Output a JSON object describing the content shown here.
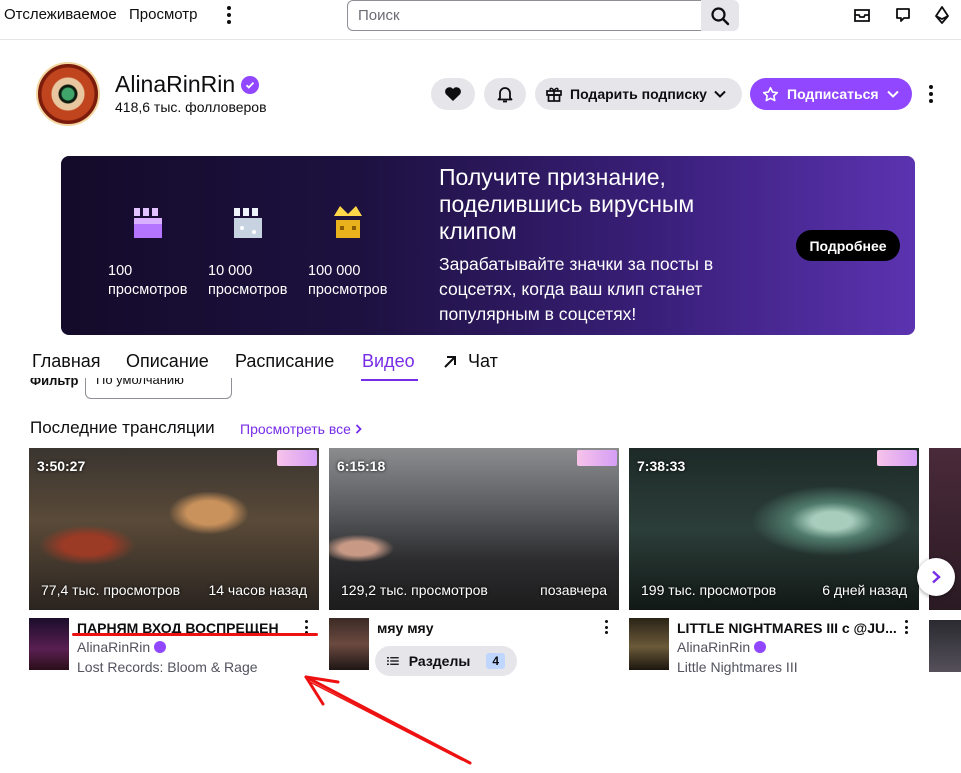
{
  "topnav": {
    "following": "Отслеживаемое",
    "browse": "Просмотр",
    "search_placeholder": "Поиск"
  },
  "channel": {
    "name": "AlinaRinRin",
    "followers": "418,6 тыс. фолловеров",
    "gift_label": "Подарить подписку",
    "subscribe_label": "Подписаться"
  },
  "banner": {
    "tiers": [
      {
        "count": "100",
        "label": "просмотров"
      },
      {
        "count": "10 000",
        "label": "просмотров"
      },
      {
        "count": "100 000",
        "label": "просмотров"
      }
    ],
    "title": "Получите признание, поделившись вирусным клипом",
    "text": "Зарабатывайте значки за посты в соцсетях, когда ваш клип станет популярным в соцсетях!",
    "button": "Подробнее"
  },
  "tabs": [
    "Главная",
    "Описание",
    "Расписание",
    "Видео",
    "Чат"
  ],
  "filter": {
    "label": "Фильтр",
    "value": "По умолчанию"
  },
  "section": {
    "title": "Последние трансляции",
    "view_all": "Просмотреть все"
  },
  "videos": [
    {
      "duration": "3:50:27",
      "views": "77,4 тыс. просмотров",
      "ago": "14 часов назад",
      "title": "ПАРНЯМ ВХОД ВОСПРЕЩЕН",
      "channel": "AlinaRinRin",
      "game": "Lost Records: Bloom & Rage"
    },
    {
      "duration": "6:15:18",
      "views": "129,2 тыс. просмотров",
      "ago": "позавчера",
      "title": "мяу мяу",
      "chapters_label": "Разделы",
      "chapters_count": "4"
    },
    {
      "duration": "7:38:33",
      "views": "199 тыс. просмотров",
      "ago": "6 дней назад",
      "title": "LITTLE NIGHTMARES III с @JU...",
      "channel": "AlinaRinRin",
      "game": "Little Nightmares III"
    }
  ],
  "colors": {
    "accent": "#9147ff",
    "accent_text": "#772ce8",
    "annotation": "#ee1111"
  }
}
